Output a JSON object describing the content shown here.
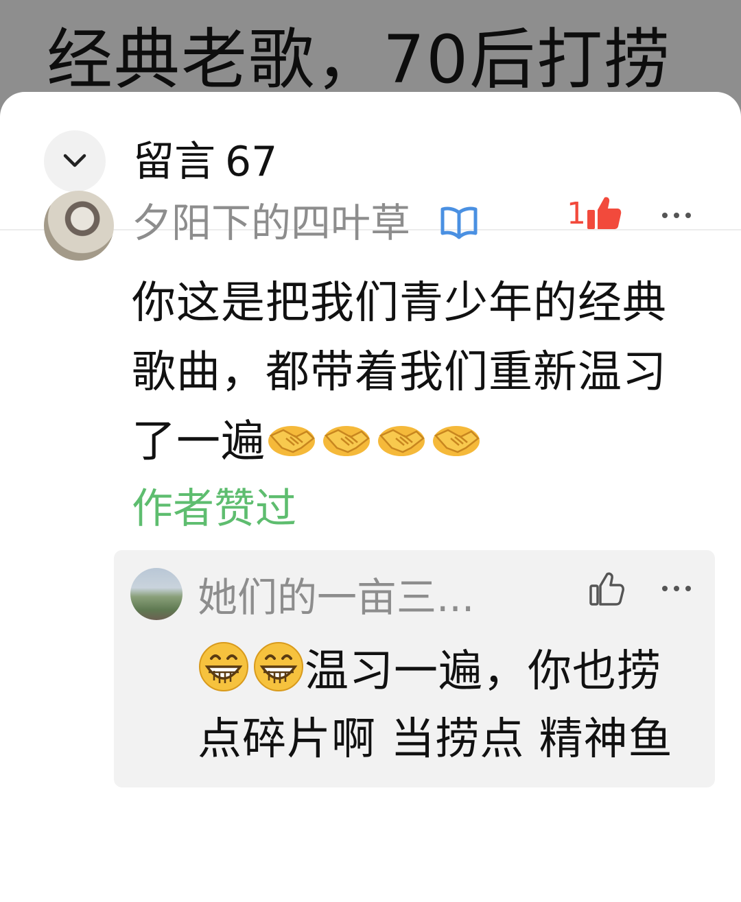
{
  "article": {
    "title": "经典老歌，70后打捞"
  },
  "comments_panel": {
    "title": "留言",
    "count": "67"
  },
  "comment": {
    "username": "夕阳下的四叶草",
    "like_count": "1",
    "text": "你这是把我们青少年的经典歌曲，都带着我们重新温习了一遍",
    "emoji": [
      "handshake",
      "handshake",
      "handshake",
      "handshake"
    ],
    "author_liked_label": "作者赞过"
  },
  "reply": {
    "username": "她们的一亩三...",
    "emoji": [
      "grinning-face",
      "grinning-face"
    ],
    "text": "温习一遍，你也捞点碎片啊 当捞点  精神鱼"
  },
  "colors": {
    "like_active": "#f24a3c",
    "author_liked": "#5ebd6f",
    "verified_badge": "#4a90e2",
    "username": "#8d8d8d"
  }
}
